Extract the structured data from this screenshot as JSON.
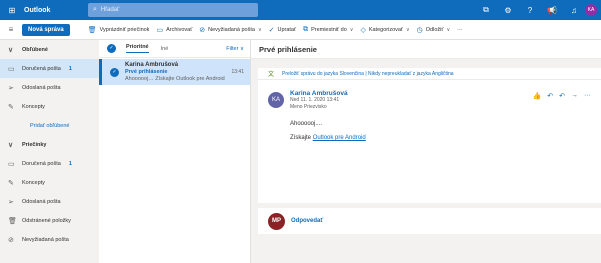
{
  "app": {
    "name": "Outlook"
  },
  "search": {
    "placeholder": "Hľadať"
  },
  "top_icons": [
    "skype-icon",
    "settings-icon",
    "help-icon",
    "megaphone-icon",
    "notification-icon"
  ],
  "user_initials": "KA",
  "toolbar": {
    "new_message": "Nová správa",
    "items": [
      {
        "label": "Vyprázdniť priečinok",
        "icon": "trash-icon",
        "chevron": false
      },
      {
        "label": "Archivovať",
        "icon": "archive-icon",
        "chevron": false
      },
      {
        "label": "Nevyžiadaná pošta",
        "icon": "block-icon",
        "chevron": true
      },
      {
        "label": "Upratať",
        "icon": "sweep-icon",
        "chevron": false
      },
      {
        "label": "Premiestniť do",
        "icon": "move-icon",
        "chevron": true
      },
      {
        "label": "Kategorizovať",
        "icon": "tag-icon",
        "chevron": true
      },
      {
        "label": "Odložiť",
        "icon": "clock-icon",
        "chevron": true
      },
      {
        "label": "···",
        "icon": "",
        "chevron": false
      }
    ]
  },
  "nav": {
    "favorites_header": "Obľúbené",
    "favorites": [
      {
        "label": "Doručená pošta",
        "count": "1"
      },
      {
        "label": "Odoslaná pošta",
        "count": ""
      },
      {
        "label": "Koncepty",
        "count": ""
      }
    ],
    "add_favorite": "Pridať obľúbené",
    "folders_header": "Priečinky",
    "folders": [
      {
        "label": "Doručená pošta",
        "count": "1"
      },
      {
        "label": "Koncepty",
        "count": ""
      },
      {
        "label": "Odoslaná pošta",
        "count": ""
      },
      {
        "label": "Odstránené položky",
        "count": ""
      },
      {
        "label": "Nevyžiadaná pošta",
        "count": ""
      }
    ]
  },
  "message_list": {
    "tab_focused": "Prioritné",
    "tab_other": "Iné",
    "filter": "Filter",
    "items": [
      {
        "from": "Karina Ambrušová",
        "subject": "Prvé prihlásenie",
        "time": "13:41",
        "preview": "Ahoooooj… Získajte Outlook pre Android"
      }
    ]
  },
  "reading": {
    "subject": "Prvé prihlásenie",
    "translate_text": "Preložiť správu do jazyka Slovenčina | Nikdy nepreukladať z jazyka Angličtina",
    "sender_initials": "KA",
    "sender_name": "Karina Ambrušová",
    "date": "Ned 11. 1. 2020 13:41",
    "to": "Meno Priezvisko",
    "body_line1": "Ahoooooj....",
    "body_line2_prefix": "Získajte ",
    "body_link": "Outlook pre Android",
    "reply_initials": "MP",
    "reply_label": "Odpovedať"
  }
}
